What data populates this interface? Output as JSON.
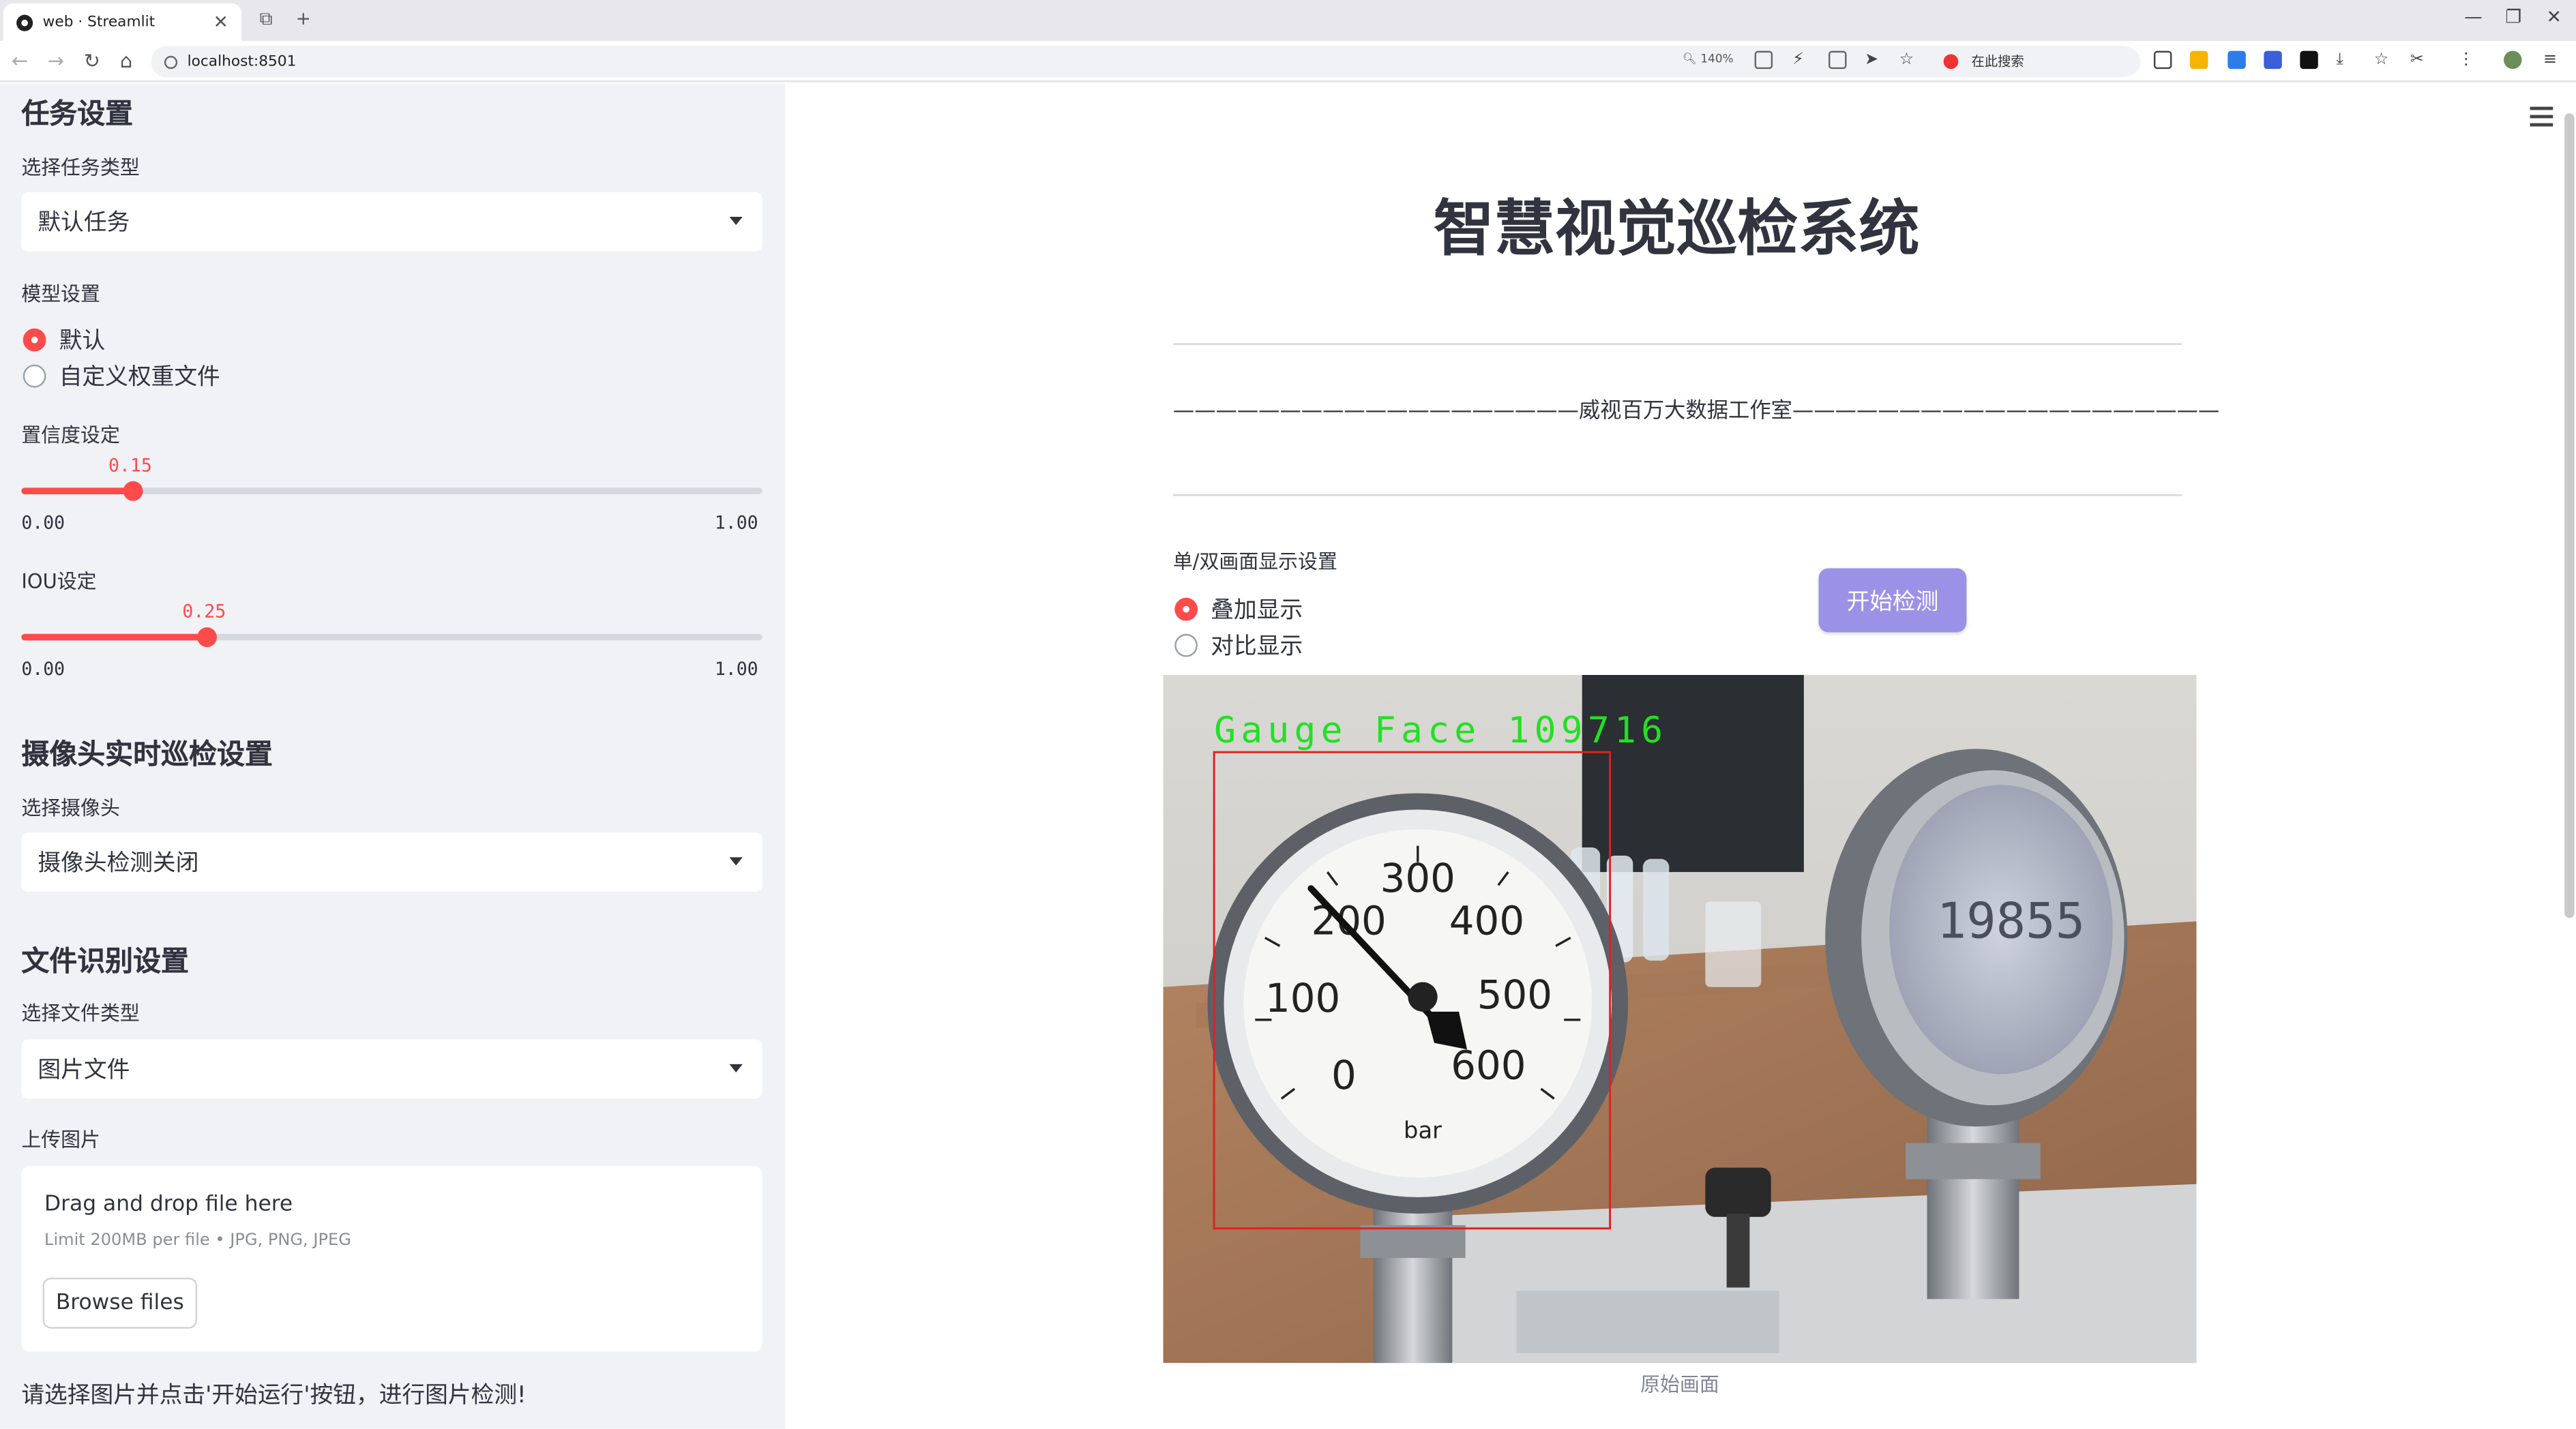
{
  "browser": {
    "tab_title": "web · Streamlit",
    "url": "localhost:8501",
    "zoom": "140%",
    "search_text": "在此搜索"
  },
  "sidebar": {
    "task_section_title": "任务设置",
    "task_type_label": "选择任务类型",
    "task_type_value": "默认任务",
    "model_label": "模型设置",
    "model_options": [
      "默认",
      "自定义权重文件"
    ],
    "model_selected": 0,
    "confidence_label": "置信度设定",
    "confidence_value": "0.15",
    "confidence_fraction": 0.15,
    "confidence_min": "0.00",
    "confidence_max": "1.00",
    "iou_label": "IOU设定",
    "iou_value": "0.25",
    "iou_fraction": 0.25,
    "iou_min": "0.00",
    "iou_max": "1.00",
    "camera_section_title": "摄像头实时巡检设置",
    "camera_label": "选择摄像头",
    "camera_value": "摄像头检测关闭",
    "file_section_title": "文件识别设置",
    "file_type_label": "选择文件类型",
    "file_type_value": "图片文件",
    "upload_label": "上传图片",
    "upload_title": "Drag and drop file here",
    "upload_hint": "Limit 200MB per file • JPG, PNG, JPEG",
    "browse_label": "Browse files",
    "note": "请选择图片并点击'开始运行'按钮，进行图片检测!"
  },
  "main": {
    "title": "智慧视觉巡检系统",
    "subtitle": "———————————————————威视百万大数据工作室————————————————————",
    "display_label": "单/双画面显示设置",
    "display_options": [
      "叠加显示",
      "对比显示"
    ],
    "display_selected": 0,
    "start_button": "开始检测",
    "detection_label": "Gauge Face 109716",
    "image_caption": "原始画面",
    "gauge_numbers": [
      "300",
      "200",
      "400",
      "100",
      "500",
      "0",
      "600",
      "bar"
    ],
    "digital_reading": "19855"
  },
  "colors": {
    "accent": "#ff4b4b",
    "button": "#9b92e8",
    "sidebar_bg": "#f0f2f6",
    "detection_box": "#e02020",
    "detection_text": "#22e022"
  }
}
